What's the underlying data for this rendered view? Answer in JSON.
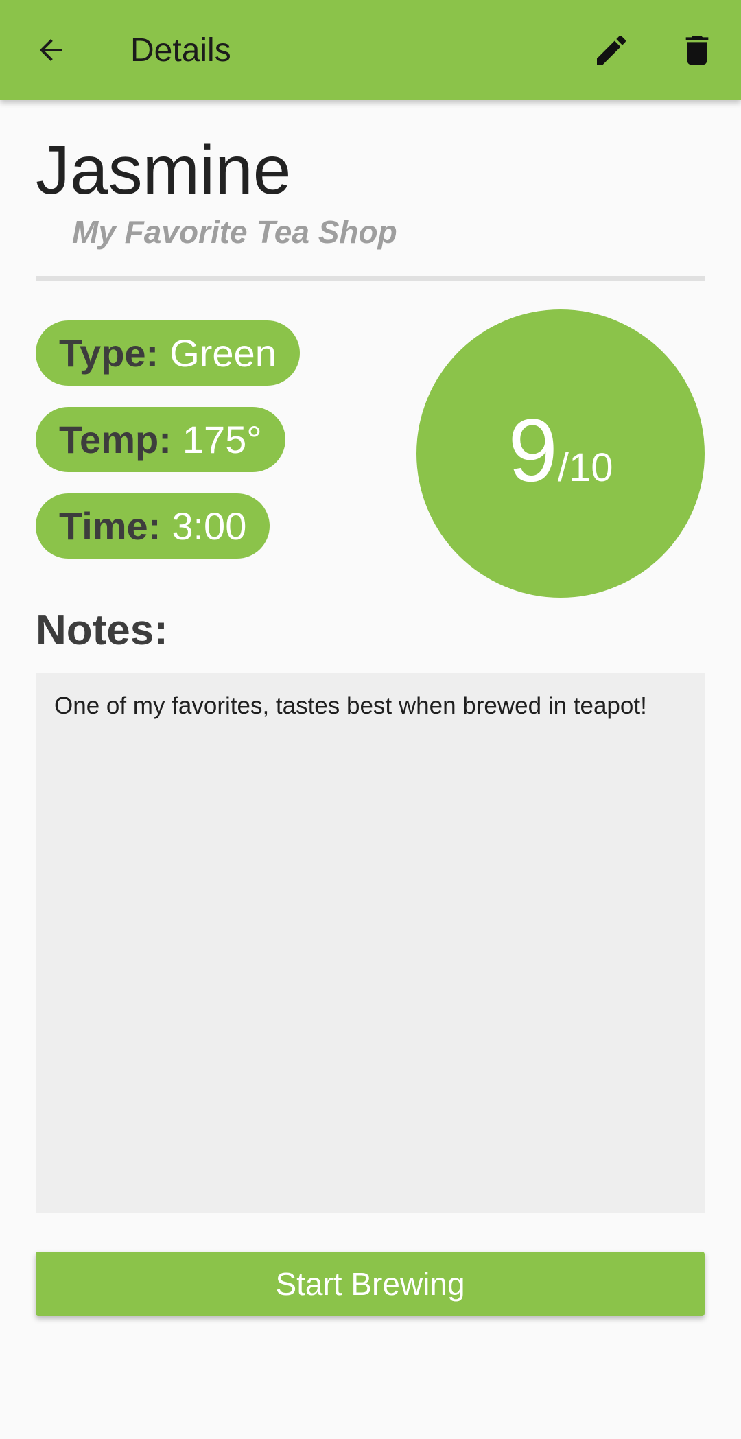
{
  "appbar": {
    "title": "Details",
    "back_icon": "arrow-back-icon",
    "edit_icon": "pencil-icon",
    "delete_icon": "trash-icon",
    "color": "#8bc34a"
  },
  "tea": {
    "name": "Jasmine",
    "shop": "My Favorite Tea Shop"
  },
  "details": {
    "type_label": "Type:",
    "type_value": "Green",
    "temp_label": "Temp:",
    "temp_value": "175°",
    "time_label": "Time:",
    "time_value": "3:00"
  },
  "rating": {
    "value": "9",
    "suffix": "/10"
  },
  "notes": {
    "label": "Notes:",
    "text": "One of my favorites, tastes best when brewed in teapot!"
  },
  "actions": {
    "start_label": "Start Brewing"
  }
}
